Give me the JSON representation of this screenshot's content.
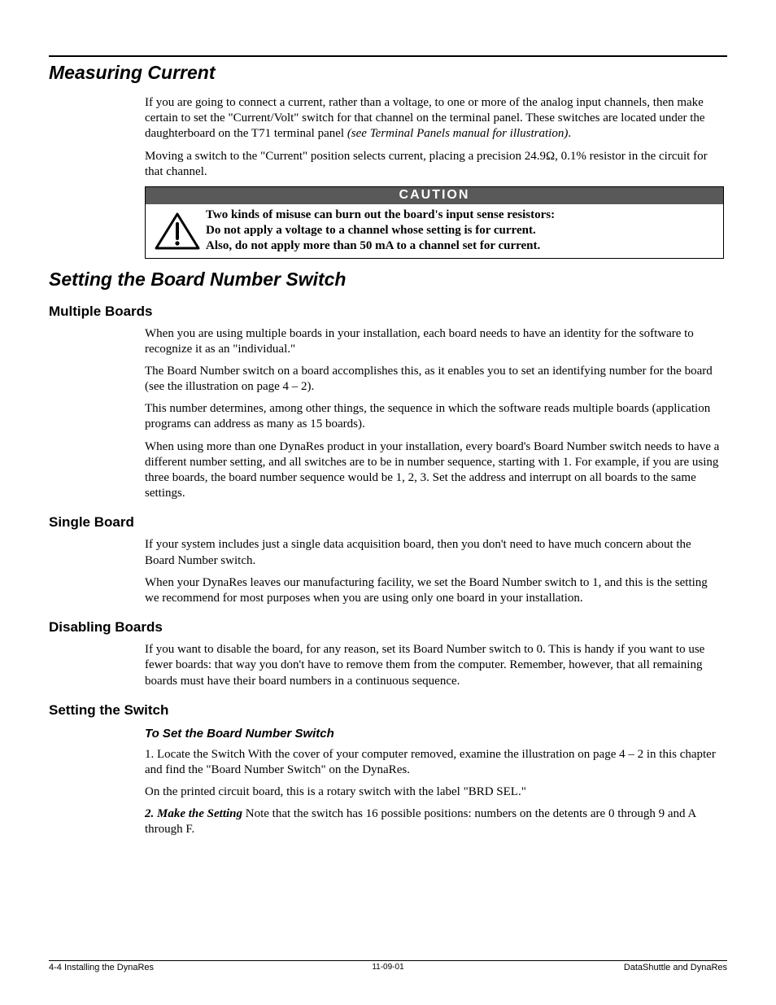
{
  "sections": {
    "measuring_current": {
      "title": "Measuring Current",
      "p1a": "If you are going to connect a current, rather than a voltage, to one or more of the analog input channels, then make certain to set the \"Current/Volt\" switch for that channel on the terminal panel. These switches are located under the daughterboard on the T71 terminal panel ",
      "p1b_ital": "(see Terminal Panels manual for illustration)",
      "p1c": ".",
      "p2": "Moving a switch to the \"Current\" position selects current, placing a precision 24.9Ω, 0.1% resistor in the circuit for that channel."
    },
    "caution": {
      "header": "CAUTION",
      "line1": "Two kinds of misuse can burn out the board's input sense resistors:",
      "line2": "Do not apply a voltage to a channel whose setting is for current.",
      "line3": "Also, do not apply more than 50 mA to a channel set for current."
    },
    "setting_board": {
      "title": "Setting the Board Number Switch"
    },
    "multiple_boards": {
      "title": "Multiple Boards",
      "p1": "When you are using multiple boards in your installation, each board needs to have an identity for the software to recognize it as an \"individual.\"",
      "p2": "The Board Number switch on a board accomplishes this, as it enables you to set an identifying number for the board (see the illustration on page 4 – 2).",
      "p3": "This number determines, among other things, the sequence in which the software reads multiple boards (application programs can address as many as 15 boards).",
      "p4": "When using more than one DynaRes product in your installation, every board's Board Number switch needs to have a different number setting, and all switches are to be in number sequence, starting with 1. For example, if you are using three boards, the board number sequence would be 1, 2, 3.  Set the address and interrupt on all boards to the same settings."
    },
    "single_board": {
      "title": "Single Board",
      "p1": "If your system includes just a single data acquisition board, then you don't need to have much concern about the Board Number switch.",
      "p2": "When your DynaRes leaves our manufacturing facility, we set the Board Number switch to 1, and this is the setting we recommend for most purposes when you are using only one board in your installation."
    },
    "disabling_boards": {
      "title": "Disabling Boards",
      "p1": "If you want to disable the board, for any reason, set its Board Number switch to 0. This is handy if you want to use fewer boards: that way you don't have to remove them from the computer. Remember, however, that all remaining boards must have their board numbers in a continuous sequence."
    },
    "setting_switch": {
      "title": "Setting the Switch",
      "subhead": "To Set the Board Number Switch",
      "s1a": "1.  Locate the Switch  With the cover of your computer removed, examine the illustration on page 4 – 2 in this chapter and find the \"Board Number Switch\" on the DynaRes.",
      "s1b": "On the printed circuit board, this is a rotary switch with the label \"BRD SEL.\"",
      "s2_lead_bold_ital": "2.  Make the Setting",
      "s2_rest": "  Note that the switch has 16 possible positions: numbers on the detents are 0 through 9 and A through F."
    }
  },
  "footer": {
    "left": "4-4   Installing the DynaRes",
    "center": "11-09-01",
    "right": "DataShuttle and DynaRes"
  }
}
